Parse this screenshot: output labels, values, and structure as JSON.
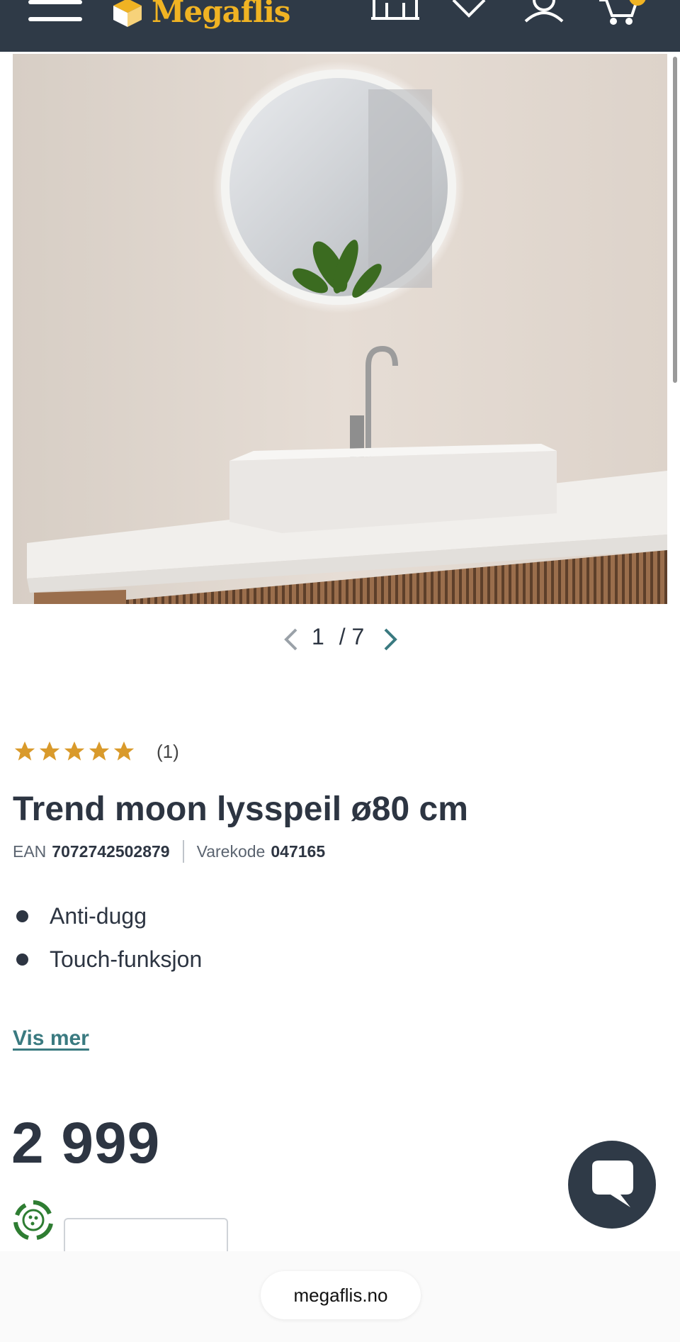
{
  "header": {
    "brand": "Megaflis",
    "icons": [
      "hamburger-menu-icon",
      "store-icon",
      "heart-icon",
      "user-icon",
      "cart-icon"
    ],
    "brand_color": "#f0b323",
    "background_color": "#2f3a47"
  },
  "gallery": {
    "current": "1",
    "total": "/ 7",
    "image_alt": "Trend moon lysspeil ø80 cm"
  },
  "product": {
    "rating_stars": 5,
    "rating_count": "(1)",
    "title": "Trend moon lysspeil ø80 cm",
    "ean_label": "EAN",
    "ean_value": "7072742502879",
    "sku_label": "Varekode",
    "sku_value": "047165",
    "features": [
      "Anti-dugg",
      "Touch-funksjon"
    ],
    "show_more": "Vis mer",
    "price": "2 999"
  },
  "browser": {
    "url": "megaflis.no"
  },
  "colors": {
    "star": "#d99a2b",
    "link": "#3a7a80",
    "text": "#2d3542",
    "eco_green": "#2e7d32"
  }
}
